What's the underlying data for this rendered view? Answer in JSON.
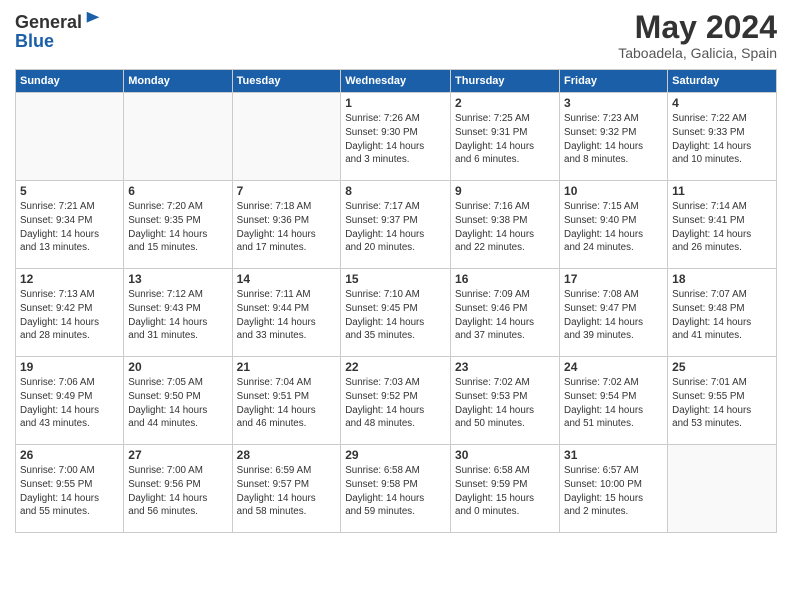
{
  "header": {
    "logo_line1": "General",
    "logo_line2": "Blue",
    "month": "May 2024",
    "location": "Taboadela, Galicia, Spain"
  },
  "days_of_week": [
    "Sunday",
    "Monday",
    "Tuesday",
    "Wednesday",
    "Thursday",
    "Friday",
    "Saturday"
  ],
  "weeks": [
    [
      {
        "day": "",
        "info": ""
      },
      {
        "day": "",
        "info": ""
      },
      {
        "day": "",
        "info": ""
      },
      {
        "day": "1",
        "info": "Sunrise: 7:26 AM\nSunset: 9:30 PM\nDaylight: 14 hours\nand 3 minutes."
      },
      {
        "day": "2",
        "info": "Sunrise: 7:25 AM\nSunset: 9:31 PM\nDaylight: 14 hours\nand 6 minutes."
      },
      {
        "day": "3",
        "info": "Sunrise: 7:23 AM\nSunset: 9:32 PM\nDaylight: 14 hours\nand 8 minutes."
      },
      {
        "day": "4",
        "info": "Sunrise: 7:22 AM\nSunset: 9:33 PM\nDaylight: 14 hours\nand 10 minutes."
      }
    ],
    [
      {
        "day": "5",
        "info": "Sunrise: 7:21 AM\nSunset: 9:34 PM\nDaylight: 14 hours\nand 13 minutes."
      },
      {
        "day": "6",
        "info": "Sunrise: 7:20 AM\nSunset: 9:35 PM\nDaylight: 14 hours\nand 15 minutes."
      },
      {
        "day": "7",
        "info": "Sunrise: 7:18 AM\nSunset: 9:36 PM\nDaylight: 14 hours\nand 17 minutes."
      },
      {
        "day": "8",
        "info": "Sunrise: 7:17 AM\nSunset: 9:37 PM\nDaylight: 14 hours\nand 20 minutes."
      },
      {
        "day": "9",
        "info": "Sunrise: 7:16 AM\nSunset: 9:38 PM\nDaylight: 14 hours\nand 22 minutes."
      },
      {
        "day": "10",
        "info": "Sunrise: 7:15 AM\nSunset: 9:40 PM\nDaylight: 14 hours\nand 24 minutes."
      },
      {
        "day": "11",
        "info": "Sunrise: 7:14 AM\nSunset: 9:41 PM\nDaylight: 14 hours\nand 26 minutes."
      }
    ],
    [
      {
        "day": "12",
        "info": "Sunrise: 7:13 AM\nSunset: 9:42 PM\nDaylight: 14 hours\nand 28 minutes."
      },
      {
        "day": "13",
        "info": "Sunrise: 7:12 AM\nSunset: 9:43 PM\nDaylight: 14 hours\nand 31 minutes."
      },
      {
        "day": "14",
        "info": "Sunrise: 7:11 AM\nSunset: 9:44 PM\nDaylight: 14 hours\nand 33 minutes."
      },
      {
        "day": "15",
        "info": "Sunrise: 7:10 AM\nSunset: 9:45 PM\nDaylight: 14 hours\nand 35 minutes."
      },
      {
        "day": "16",
        "info": "Sunrise: 7:09 AM\nSunset: 9:46 PM\nDaylight: 14 hours\nand 37 minutes."
      },
      {
        "day": "17",
        "info": "Sunrise: 7:08 AM\nSunset: 9:47 PM\nDaylight: 14 hours\nand 39 minutes."
      },
      {
        "day": "18",
        "info": "Sunrise: 7:07 AM\nSunset: 9:48 PM\nDaylight: 14 hours\nand 41 minutes."
      }
    ],
    [
      {
        "day": "19",
        "info": "Sunrise: 7:06 AM\nSunset: 9:49 PM\nDaylight: 14 hours\nand 43 minutes."
      },
      {
        "day": "20",
        "info": "Sunrise: 7:05 AM\nSunset: 9:50 PM\nDaylight: 14 hours\nand 44 minutes."
      },
      {
        "day": "21",
        "info": "Sunrise: 7:04 AM\nSunset: 9:51 PM\nDaylight: 14 hours\nand 46 minutes."
      },
      {
        "day": "22",
        "info": "Sunrise: 7:03 AM\nSunset: 9:52 PM\nDaylight: 14 hours\nand 48 minutes."
      },
      {
        "day": "23",
        "info": "Sunrise: 7:02 AM\nSunset: 9:53 PM\nDaylight: 14 hours\nand 50 minutes."
      },
      {
        "day": "24",
        "info": "Sunrise: 7:02 AM\nSunset: 9:54 PM\nDaylight: 14 hours\nand 51 minutes."
      },
      {
        "day": "25",
        "info": "Sunrise: 7:01 AM\nSunset: 9:55 PM\nDaylight: 14 hours\nand 53 minutes."
      }
    ],
    [
      {
        "day": "26",
        "info": "Sunrise: 7:00 AM\nSunset: 9:55 PM\nDaylight: 14 hours\nand 55 minutes."
      },
      {
        "day": "27",
        "info": "Sunrise: 7:00 AM\nSunset: 9:56 PM\nDaylight: 14 hours\nand 56 minutes."
      },
      {
        "day": "28",
        "info": "Sunrise: 6:59 AM\nSunset: 9:57 PM\nDaylight: 14 hours\nand 58 minutes."
      },
      {
        "day": "29",
        "info": "Sunrise: 6:58 AM\nSunset: 9:58 PM\nDaylight: 14 hours\nand 59 minutes."
      },
      {
        "day": "30",
        "info": "Sunrise: 6:58 AM\nSunset: 9:59 PM\nDaylight: 15 hours\nand 0 minutes."
      },
      {
        "day": "31",
        "info": "Sunrise: 6:57 AM\nSunset: 10:00 PM\nDaylight: 15 hours\nand 2 minutes."
      },
      {
        "day": "",
        "info": ""
      }
    ]
  ]
}
